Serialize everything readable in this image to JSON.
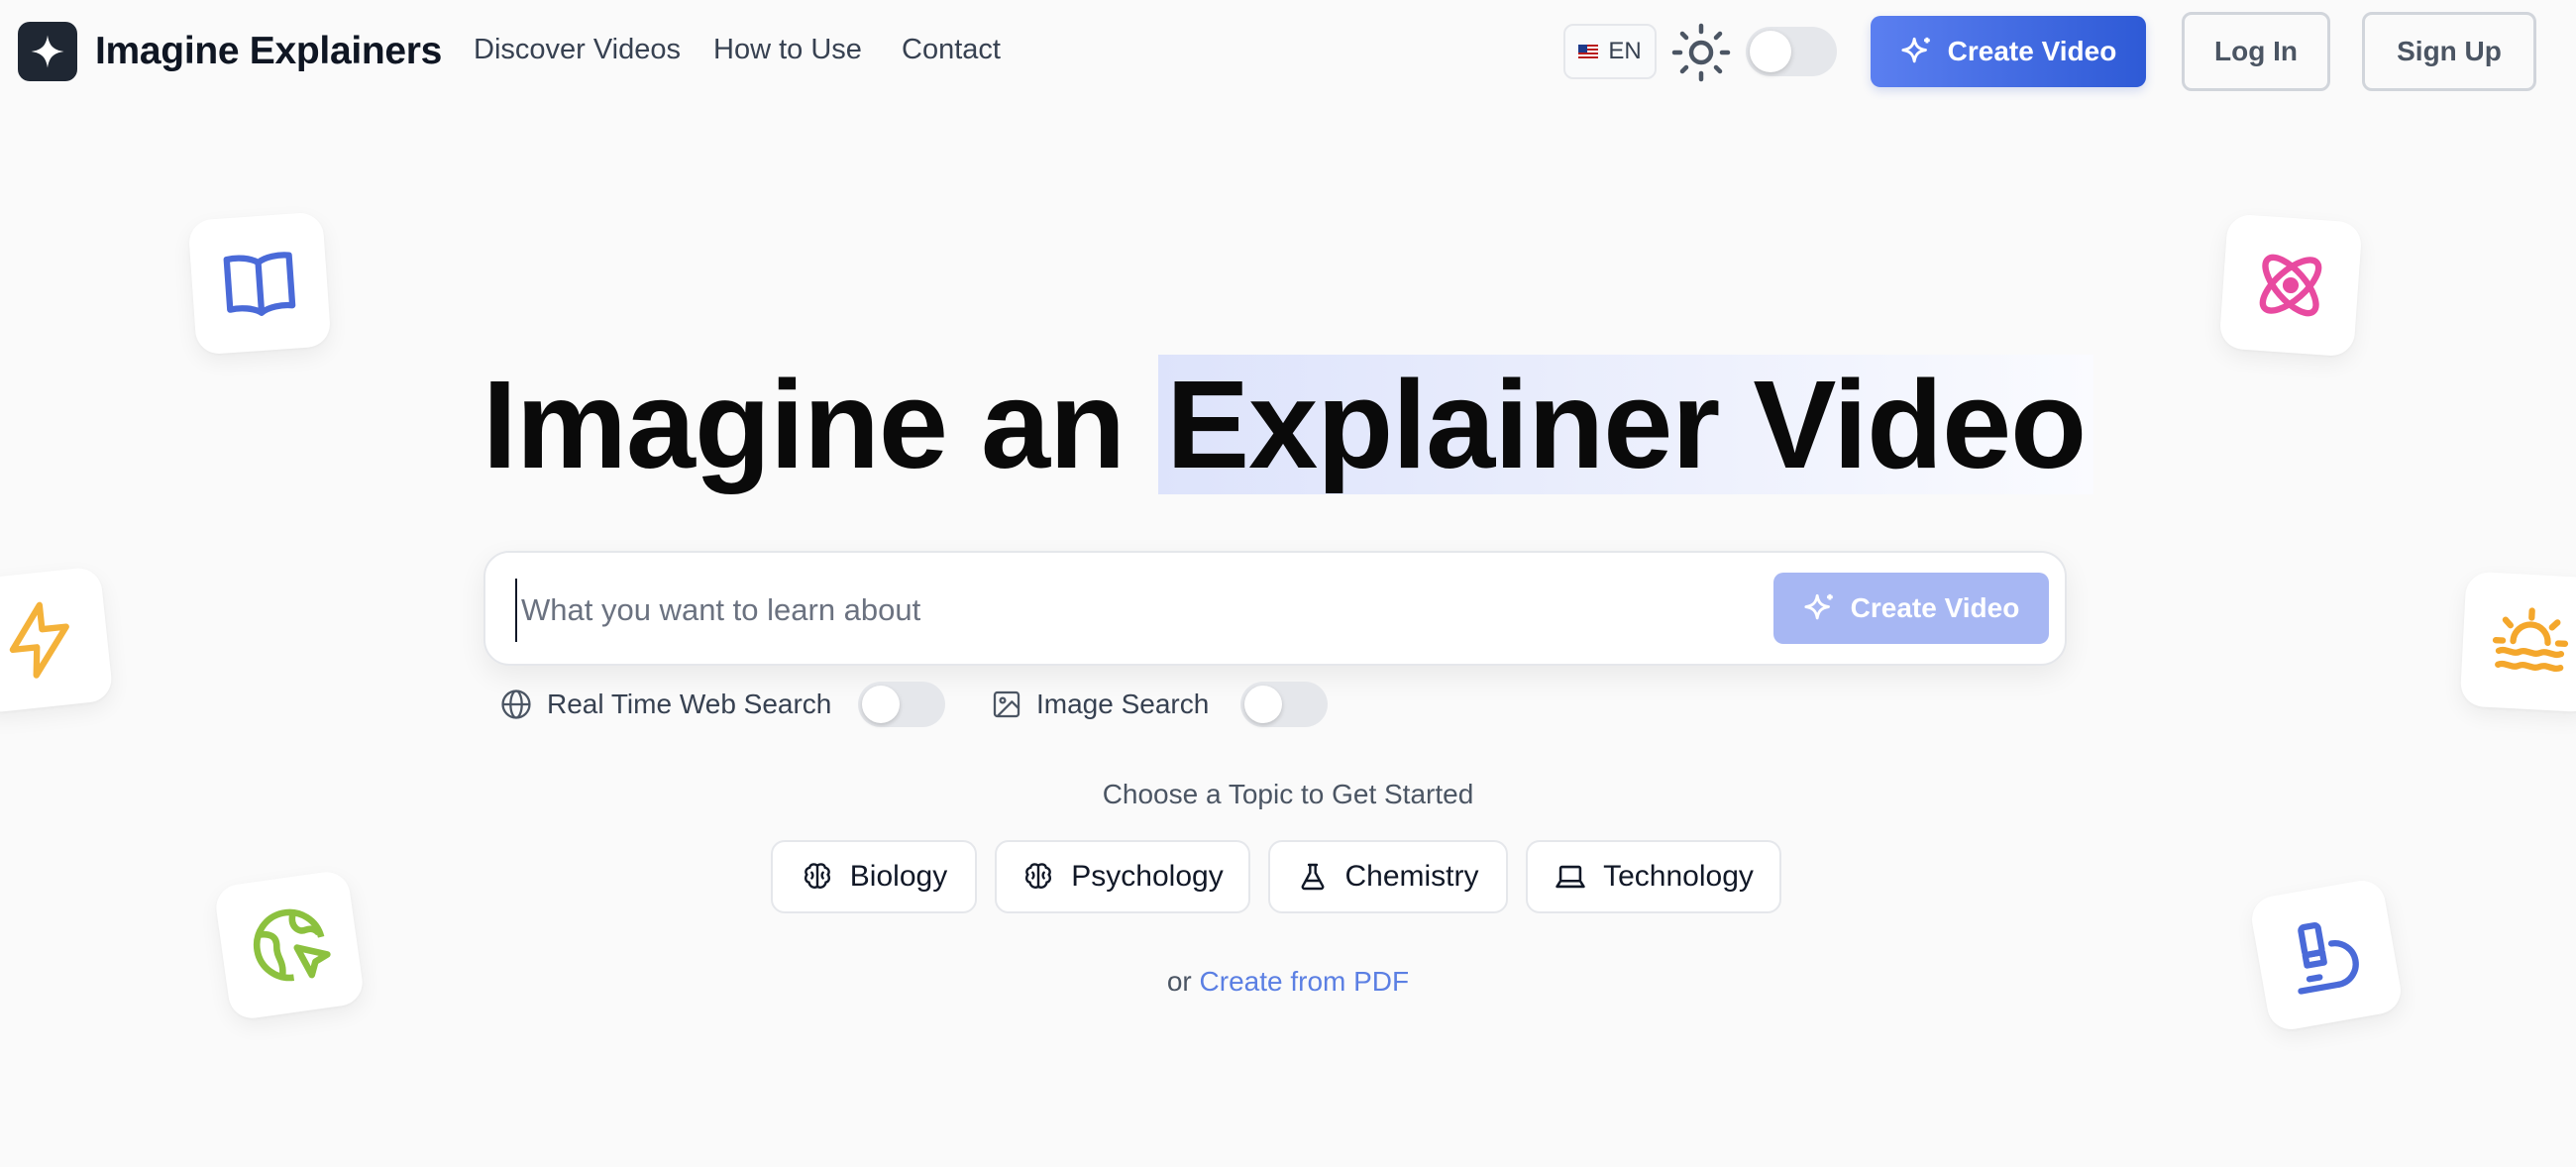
{
  "header": {
    "brand": "Imagine Explainers",
    "nav": [
      "Discover Videos",
      "How to Use",
      "Contact"
    ],
    "language": "EN",
    "create_video": "Create Video",
    "log_in": "Log In",
    "sign_up": "Sign Up"
  },
  "hero": {
    "title_part1": "Imagine an",
    "title_highlight": "Explainer Video"
  },
  "search": {
    "placeholder": "What you want to learn about",
    "value": "",
    "button": "Create Video"
  },
  "options": {
    "web_search": "Real Time Web Search",
    "image_search": "Image Search"
  },
  "topics": {
    "heading": "Choose a Topic to Get Started",
    "items": [
      "Biology",
      "Psychology",
      "Chemistry",
      "Technology"
    ]
  },
  "pdf": {
    "prefix": "or",
    "link": "Create from PDF"
  },
  "colors": {
    "primary": "#2e5ad6",
    "primary_light": "#5b7ff0",
    "link": "#5b7fe3",
    "book": "#4a6ad8",
    "atom": "#e84aa0",
    "bolt": "#f4b23a",
    "sunset": "#f4a72c",
    "globe": "#8cc13f",
    "microscope": "#4a6ad8"
  },
  "icons": [
    "logo-sparkle-icon",
    "flag-us-icon",
    "sun-icon",
    "sparkles-icon",
    "globe-icon",
    "image-icon",
    "brain-icon",
    "flask-icon",
    "laptop-icon",
    "book-icon",
    "atom-icon",
    "lightning-icon",
    "sunset-icon",
    "globe-pointer-icon",
    "microscope-icon"
  ]
}
